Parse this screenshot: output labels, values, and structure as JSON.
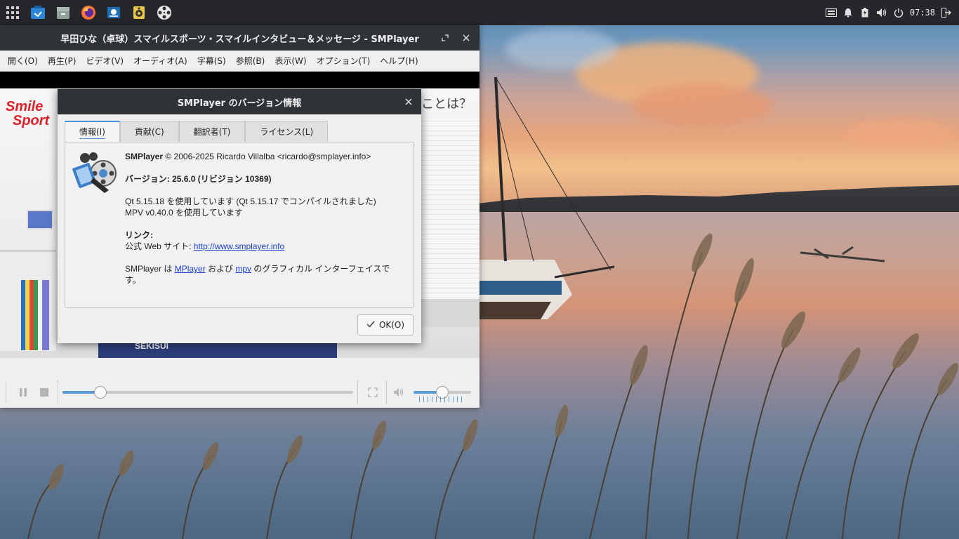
{
  "taskbar": {
    "apps": [
      {
        "name": "app-grid-icon"
      },
      {
        "name": "kanagawa-install-icon"
      },
      {
        "name": "file-manager-icon"
      },
      {
        "name": "firefox-icon"
      },
      {
        "name": "monitor-app-icon"
      },
      {
        "name": "speaker-app-icon"
      },
      {
        "name": "film-reel-icon"
      }
    ],
    "clock": "07:38"
  },
  "main_window": {
    "title": "早田ひな（卓球）スマイルスポーツ・スマイルインタビュー＆メッセージ - SMPlayer",
    "menu": [
      "開く(O)",
      "再生(P)",
      "ビデオ(V)",
      "オーディオ(A)",
      "字幕(S)",
      "参照(B)",
      "表示(W)",
      "オプション(T)",
      "ヘルプ(H)"
    ],
    "video": {
      "logo_line1": "Smile",
      "logo_line2": "Sport",
      "top_caption": "ことは？",
      "sign_text": "SEKISUI"
    },
    "progress_percent": 13,
    "volume_percent": 50
  },
  "dialog": {
    "title": "SMPlayer のバージョン情報",
    "tabs": [
      "情報(I)",
      "貢献(C)",
      "翻訳者(T)",
      "ライセンス(L)"
    ],
    "copyright_app": "SMPlayer",
    "copyright_rest": " © 2006-2025 Ricardo Villalba <ricardo@smplayer.info>",
    "version": "バージョン: 25.6.0 (リビジョン 10369)",
    "qt_line": "Qt 5.15.18 を使用しています (Qt 5.15.17 でコンパイルされました)",
    "mpv_line": "MPV v0.40.0 を使用しています",
    "links_heading": "リンク:",
    "website_label": "公式 Web サイト: ",
    "website_url": "http://www.smplayer.info",
    "desc_prefix": "SMPlayer は ",
    "desc_mplayer": "MPlayer",
    "desc_mid": " および ",
    "desc_mpv": "mpv",
    "desc_suffix": " のグラフィカル インターフェイスです。",
    "ok_label": "OK(O)"
  }
}
